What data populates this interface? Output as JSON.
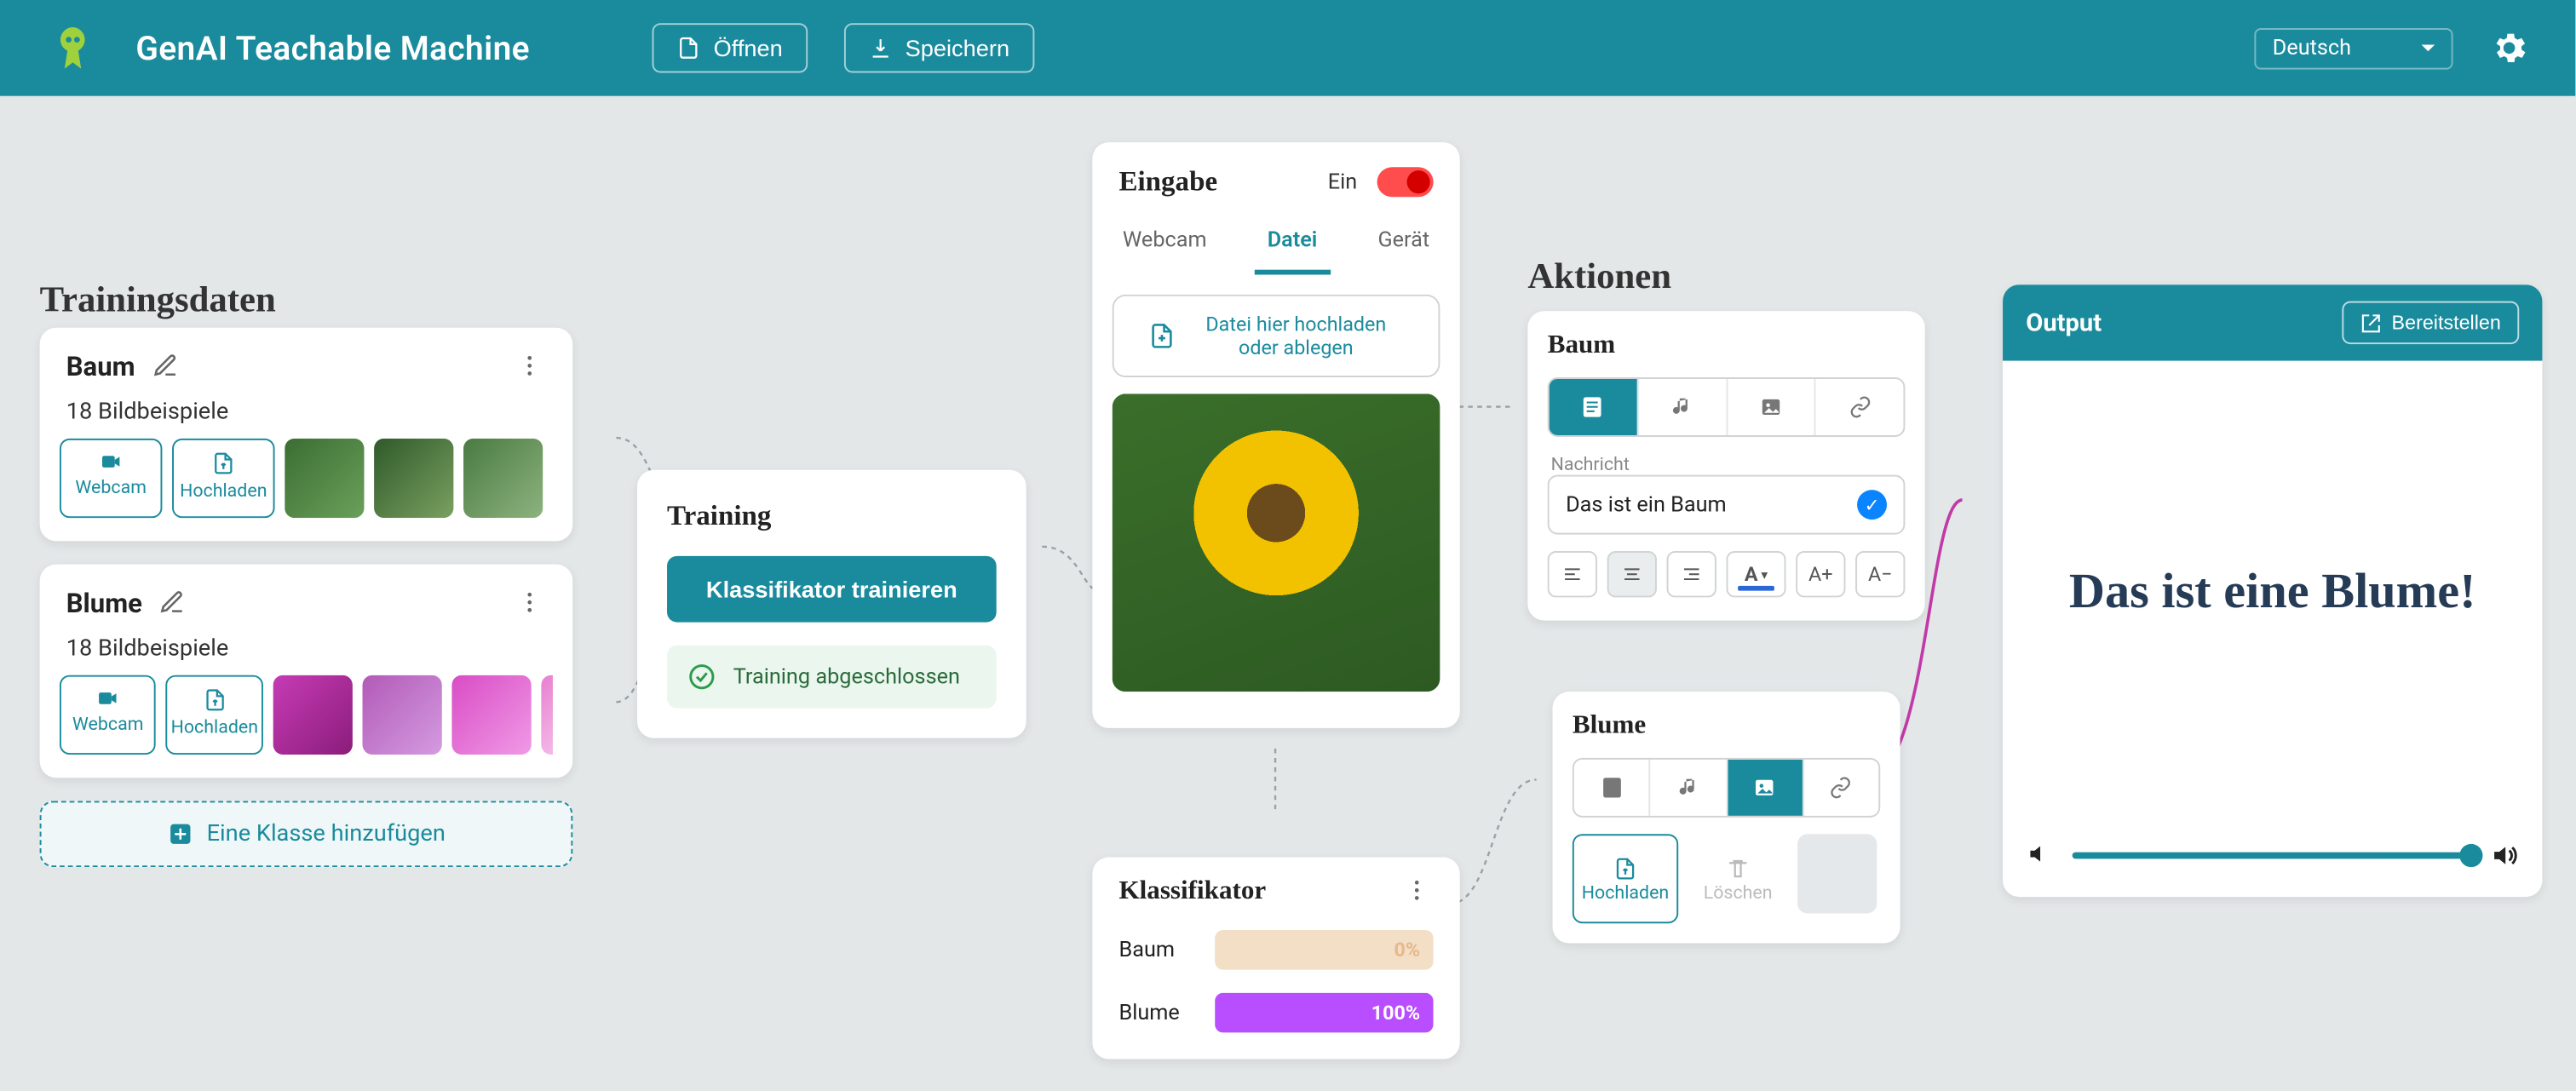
{
  "header": {
    "app_title": "GenAI Teachable Machine",
    "open_label": "Öffnen",
    "save_label": "Speichern",
    "language": "Deutsch"
  },
  "training_data": {
    "title": "Trainingsdaten",
    "webcam_label": "Webcam",
    "upload_label": "Hochladen",
    "add_class_label": "Eine Klasse hinzufügen",
    "classes": [
      {
        "name": "Baum",
        "subtitle": "18 Bildbeispiele"
      },
      {
        "name": "Blume",
        "subtitle": "18 Bildbeispiele"
      }
    ]
  },
  "training": {
    "title": "Training",
    "train_button": "Klassifikator trainieren",
    "status": "Training abgeschlossen"
  },
  "input": {
    "title": "Eingabe",
    "toggle_label": "Ein",
    "tabs": {
      "webcam": "Webcam",
      "file": "Datei",
      "device": "Gerät"
    },
    "upload_text": "Datei hier hochladen oder ablegen"
  },
  "classifier": {
    "title": "Klassifikator",
    "rows": [
      {
        "label": "Baum",
        "value": "0%",
        "pct": 0
      },
      {
        "label": "Blume",
        "value": "100%",
        "pct": 100
      }
    ]
  },
  "actions": {
    "title": "Aktionen",
    "baum": {
      "name": "Baum",
      "message_label": "Nachricht",
      "message": "Das ist ein Baum",
      "font_inc": "A+",
      "font_dec": "A−"
    },
    "blume": {
      "name": "Blume",
      "upload": "Hochladen",
      "delete": "Löschen"
    }
  },
  "output": {
    "title": "Output",
    "deploy": "Bereitstellen",
    "text": "Das ist eine Blume!"
  }
}
